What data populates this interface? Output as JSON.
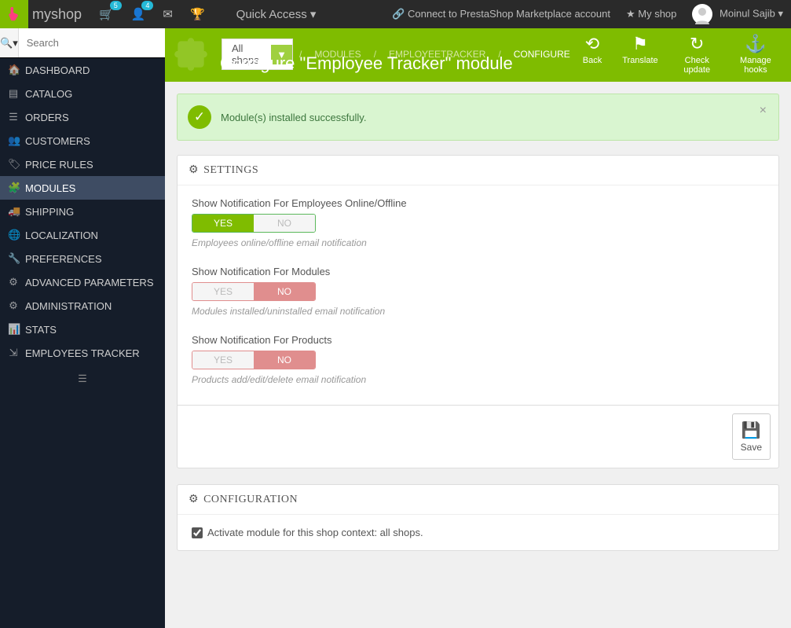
{
  "topbar": {
    "shop_name": "myshop",
    "cart_badge": "5",
    "user_badge": "4",
    "quick_access": "Quick Access",
    "marketplace": "Connect to PrestaShop Marketplace account",
    "my_shop": "My shop",
    "username": "Moinul Sajib"
  },
  "sidebar": {
    "search_placeholder": "Search",
    "items": [
      {
        "icon": "📊",
        "label": "DASHBOARD"
      },
      {
        "icon": "📘",
        "label": "CATALOG"
      },
      {
        "icon": "☰",
        "label": "ORDERS"
      },
      {
        "icon": "👥",
        "label": "CUSTOMERS"
      },
      {
        "icon": "🏷",
        "label": "PRICE RULES"
      },
      {
        "icon": "🧩",
        "label": "MODULES"
      },
      {
        "icon": "🚚",
        "label": "SHIPPING"
      },
      {
        "icon": "🌐",
        "label": "LOCALIZATION"
      },
      {
        "icon": "🔧",
        "label": "PREFERENCES"
      },
      {
        "icon": "⚙",
        "label": "ADVANCED PARAMETERS"
      },
      {
        "icon": "⚙",
        "label": "ADMINISTRATION"
      },
      {
        "icon": "📈",
        "label": "STATS"
      },
      {
        "icon": "⇲",
        "label": "EMPLOYEES TRACKER"
      }
    ]
  },
  "header": {
    "shop_selector": "All shops",
    "breadcrumb_1": "MODULES",
    "breadcrumb_2": "EMPLOYEETRACKER",
    "breadcrumb_3": "CONFIGURE",
    "title": "Configure \"Employee Tracker\" module",
    "actions": {
      "back": "Back",
      "translate": "Translate",
      "check_update": "Check update",
      "manage_hooks": "Manage hooks"
    }
  },
  "alert": {
    "message": "Module(s) installed successfully."
  },
  "settings": {
    "title": "SETTINGS",
    "yes_label": "YES",
    "no_label": "NO",
    "field1_label": "Show Notification For Employees Online/Offline",
    "field1_help": "Employees online/offline email notification",
    "field2_label": "Show Notification For Modules",
    "field2_help": "Modules installed/uninstalled email notification",
    "field3_label": "Show Notification For Products",
    "field3_help": "Products add/edit/delete email notification",
    "save": "Save"
  },
  "config": {
    "title": "CONFIGURATION",
    "activate_label": "Activate module for this shop context: all shops."
  }
}
